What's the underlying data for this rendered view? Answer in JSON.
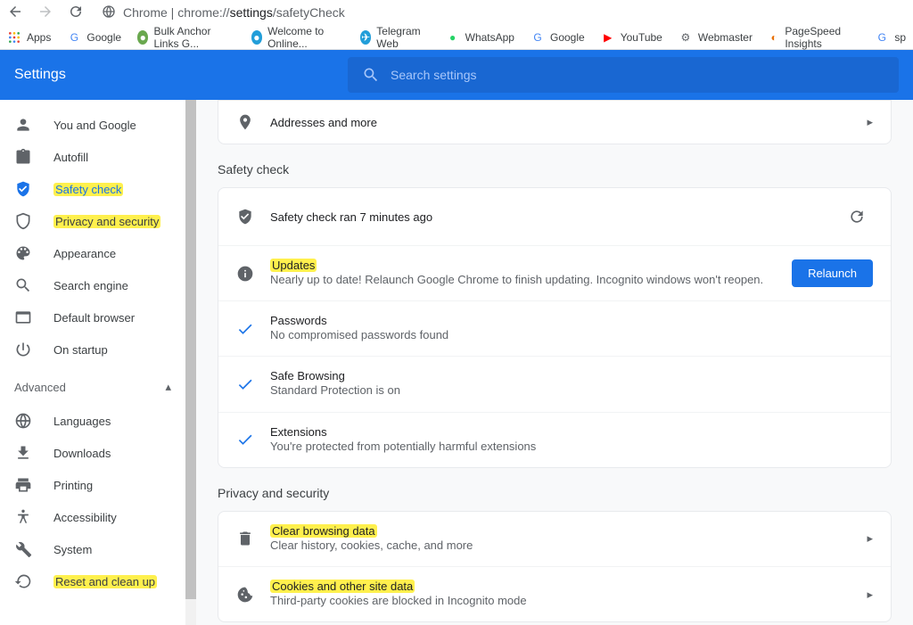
{
  "browser": {
    "address_label": "Chrome",
    "address_url": "chrome://settings/safetyCheck",
    "bookmarks_label": "Apps",
    "bookmarks": [
      {
        "label": "Google",
        "color": "#4285f4"
      },
      {
        "label": "Bulk Anchor Links G...",
        "color": "#6aa84f"
      },
      {
        "label": "Welcome to Online...",
        "color": "#229ed9"
      },
      {
        "label": "Telegram Web",
        "color": "#229ed9"
      },
      {
        "label": "WhatsApp",
        "color": "#25d366"
      },
      {
        "label": "Google",
        "color": "#4285f4"
      },
      {
        "label": "YouTube",
        "color": "#ff0000"
      },
      {
        "label": "Webmaster",
        "color": "#5f6368"
      },
      {
        "label": "PageSpeed Insights",
        "color": "#e8710a"
      },
      {
        "label": "sp",
        "color": "#4285f4"
      }
    ]
  },
  "header": {
    "title": "Settings",
    "search_placeholder": "Search settings"
  },
  "sidebar": {
    "items": [
      {
        "label": "You and Google",
        "icon": "person"
      },
      {
        "label": "Autofill",
        "icon": "clipboard"
      },
      {
        "label": "Safety check",
        "icon": "shield-check",
        "active": true,
        "highlight": true
      },
      {
        "label": "Privacy and security",
        "icon": "shield",
        "highlight": true
      },
      {
        "label": "Appearance",
        "icon": "palette"
      },
      {
        "label": "Search engine",
        "icon": "search"
      },
      {
        "label": "Default browser",
        "icon": "browser"
      },
      {
        "label": "On startup",
        "icon": "power"
      }
    ],
    "advanced": "Advanced",
    "advanced_items": [
      {
        "label": "Languages",
        "icon": "globe"
      },
      {
        "label": "Downloads",
        "icon": "download"
      },
      {
        "label": "Printing",
        "icon": "print"
      },
      {
        "label": "Accessibility",
        "icon": "accessibility"
      },
      {
        "label": "System",
        "icon": "wrench"
      },
      {
        "label": "Reset and clean up",
        "icon": "restore",
        "highlight": true
      }
    ]
  },
  "content": {
    "addresses_more": "Addresses and more",
    "safety_check_title": "Safety check",
    "safety_status": "Safety check ran 7 minutes ago",
    "updates": {
      "title": "Updates",
      "desc": "Nearly up to date! Relaunch Google Chrome to finish updating. Incognito windows won't reopen.",
      "button": "Relaunch"
    },
    "passwords": {
      "title": "Passwords",
      "desc": "No compromised passwords found"
    },
    "safe_browsing": {
      "title": "Safe Browsing",
      "desc": "Standard Protection is on"
    },
    "extensions": {
      "title": "Extensions",
      "desc": "You're protected from potentially harmful extensions"
    },
    "privacy_title": "Privacy and security",
    "clear_data": {
      "title": "Clear browsing data",
      "desc": "Clear history, cookies, cache, and more"
    },
    "cookies": {
      "title": "Cookies and other site data",
      "desc": "Third-party cookies are blocked in Incognito mode"
    }
  }
}
